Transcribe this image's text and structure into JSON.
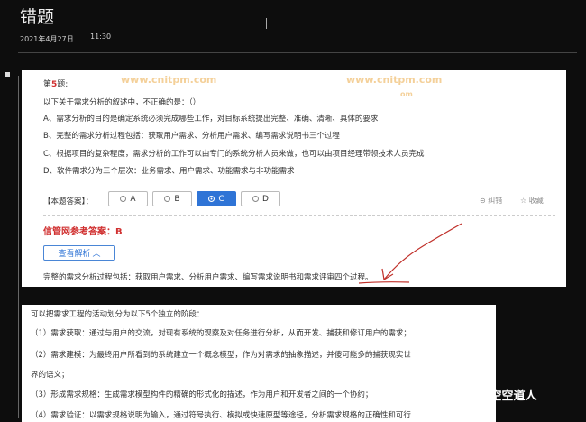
{
  "header": {
    "title": "错题",
    "date": "2021年4月27日",
    "time": "11:30"
  },
  "question": {
    "label_prefix": "第",
    "number": "5",
    "label_suffix": "题:",
    "stem": "以下关于需求分析的叙述中，不正确的是：（）",
    "options": [
      "A、需求分析的目的是确定系统必须完成哪些工作，对目标系统提出完整、准确、清晰、具体的要求",
      "B、完整的需求分析过程包括：获取用户需求、分析用户需求、编写需求说明书三个过程",
      "C、根据项目的复杂程度，需求分析的工作可以由专门的系统分析人员来做，也可以由项目经理带领技术人员完成",
      "D、软件需求分为三个层次：业务需求、用户需求、功能需求与非功能需求"
    ]
  },
  "answer_bar": {
    "label": "【本题答案】：",
    "choices": [
      "A",
      "B",
      "C",
      "D"
    ],
    "selected": "C",
    "correction": "纠错",
    "favorite": "收藏"
  },
  "reference": {
    "label": "信管网参考答案：",
    "answer": "B"
  },
  "view_button": {
    "label": "查看解析",
    "icon": "chevron-up-icon"
  },
  "explanation": "完整的需求分析过程包括：获取用户需求、分析用户需求、编写需求说明书和需求评审四个过程。",
  "watermarks": [
    "www.cnitpm.com",
    "www.cnitpm.com",
    "om"
  ],
  "notes": [
    "可以把需求工程的活动划分为以下5个独立的阶段：",
    "（1）需求获取：通过与用户的交流，对现有系统的观察及对任务进行分析，从而开发、捕获和修订用户的需求；",
    "（2）需求建模：为最终用户所看到的系统建立一个概念模型，作为对需求的抽象描述，并傻可能多的捕获现实世",
    "界的语义；",
    "（3）形成需求规格：生成需求模型构件的精确的形式化的描述，作为用户和开发者之间的一个协约；",
    "（4）需求验证：以需求规格说明为输入，通过符号执行、模拟或快速原型等途径，分析需求规格的正确性和可行"
  ],
  "attribution": "知乎 @空空道人",
  "colors": {
    "accent": "#2f74d6",
    "answer_red": "#d03030",
    "ink_red": "#c0302a"
  }
}
